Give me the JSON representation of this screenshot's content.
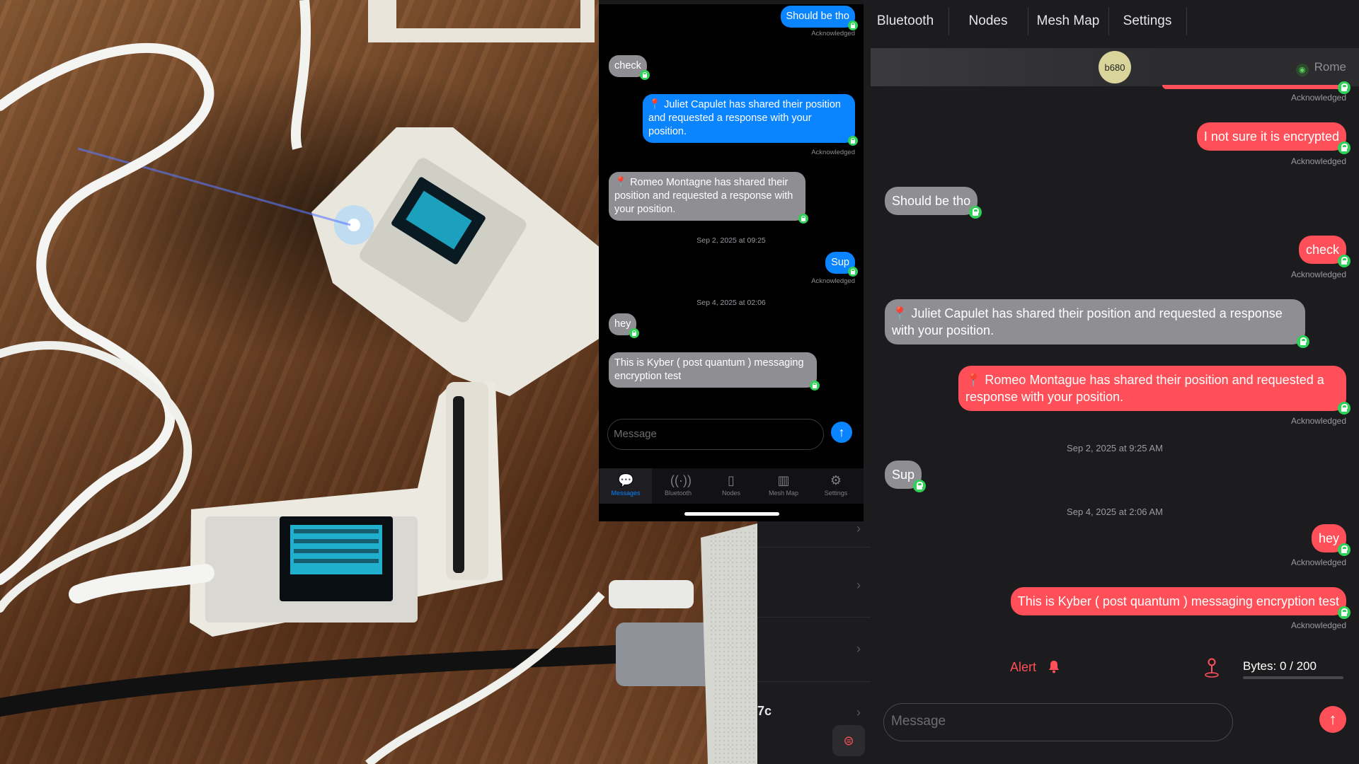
{
  "phone": {
    "messages": [
      {
        "text": "Should be tho",
        "dir": "out",
        "status": "Acknowledged"
      },
      {
        "text": "check",
        "dir": "in"
      },
      {
        "text": "📍 Juliet Capulet has shared their position and requested a response with your position.",
        "dir": "out",
        "status": "Acknowledged"
      },
      {
        "text": "📍 Romeo Montagne has shared their position and requested a response with your position.",
        "dir": "in"
      },
      {
        "text": "Sup",
        "dir": "out",
        "status": "Acknowledged"
      },
      {
        "text": "hey",
        "dir": "in"
      },
      {
        "text": "This is Kyber ( post quantum ) messaging encryption test",
        "dir": "in"
      }
    ],
    "dates": [
      "Sep 2, 2025 at 09:25",
      "Sep 4, 2025 at 02:06"
    ],
    "input_placeholder": "Message",
    "tabs": [
      {
        "label": "Messages",
        "icon": "chat-bubble-icon",
        "active": true
      },
      {
        "label": "Bluetooth",
        "icon": "antenna-icon"
      },
      {
        "label": "Nodes",
        "icon": "device-icon"
      },
      {
        "label": "Mesh Map",
        "icon": "map-icon"
      },
      {
        "label": "Settings",
        "icon": "gear-icon"
      }
    ]
  },
  "ipad": {
    "top_tabs": [
      "Bluetooth",
      "Nodes",
      "Mesh Map",
      "Settings"
    ],
    "avatar": "b680",
    "channel": "Rome",
    "messages": [
      {
        "text": "I not sure it is encrypted",
        "dir": "out",
        "status": "Acknowledged"
      },
      {
        "text": "Should be tho",
        "dir": "in"
      },
      {
        "text": "check",
        "dir": "out",
        "status": "Acknowledged"
      },
      {
        "text": "📍 Juliet Capulet has shared their position and requested a response with your position.",
        "dir": "in"
      },
      {
        "text": "📍 Romeo Montague has shared their position and requested a response with your position.",
        "dir": "out",
        "status": "Acknowledged"
      },
      {
        "text": "Sup",
        "dir": "in"
      },
      {
        "text": "hey",
        "dir": "out",
        "status": "Acknowledged"
      },
      {
        "text": "This is Kyber ( post quantum ) messaging encryption test",
        "dir": "out",
        "status": "Acknowledged"
      }
    ],
    "top_status": "Acknowledged",
    "dates": [
      "Sep 2, 2025 at 9:25 AM",
      "Sep 4, 2025 at 2:06 AM"
    ],
    "alert_label": "Alert",
    "bytes_label": "Bytes: 0 / 200",
    "bytes_used_fraction": 0,
    "input_placeholder": "Message"
  },
  "behind_fragment": "7c",
  "colors": {
    "outgoing_blue": "#0b84ff",
    "outgoing_red": "#ff4f58",
    "incoming_gray": "#8e8e93",
    "lock_green": "#30d158"
  }
}
